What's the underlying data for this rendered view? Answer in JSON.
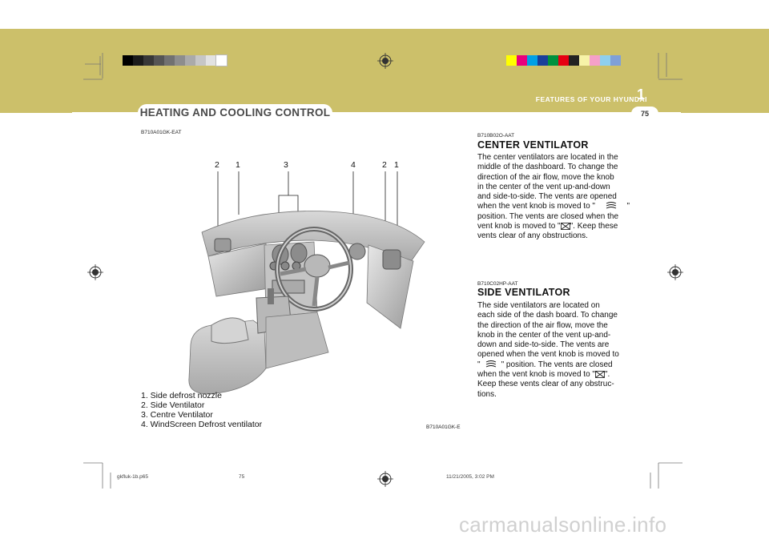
{
  "colors": {
    "header_band": "#ccc06a",
    "text": "#111111",
    "accent_white": "#ffffff"
  },
  "registration_bars": {
    "gray_scale": [
      "#000000",
      "#1c1c1c",
      "#383838",
      "#555555",
      "#717171",
      "#8d8d8d",
      "#aaaaaa",
      "#c6c6c6",
      "#e2e2e2",
      "#ffffff"
    ],
    "color_scale": [
      "#ffff00",
      "#e8007d",
      "#00a0e6",
      "#1a3f9a",
      "#00913e",
      "#e60012",
      "#222222",
      "#f7f3a8",
      "#f5a0c8",
      "#8ecfee",
      "#7fa0d8"
    ]
  },
  "header": {
    "section_title": "HEATING AND COOLING CONTROL",
    "chapter_label": "FEATURES OF YOUR HYUNDAI",
    "chapter_number": "1",
    "page_number": "75"
  },
  "figure": {
    "code_top": "B710A01GK-EAT",
    "code_bottom": "B710A01GK-E",
    "callouts": [
      "2",
      "1",
      "3",
      "4",
      "2",
      "1"
    ],
    "legend": [
      "1. Side defrost nozzle",
      "2. Side Ventilator",
      "3. Centre Ventilator",
      "4. WindScreen Defrost ventilator"
    ]
  },
  "sections": {
    "center": {
      "code": "B710B02O-AAT",
      "heading": "CENTER VENTILATOR",
      "lines": [
        "The center ventilators are located in the",
        "middle of the dashboard. To change the",
        "direction of the air flow, move the knob",
        "in the center of the vent up-and-down",
        "and side-to-side. The vents are opened",
        "when the vent knob is moved to \"",
        "\"",
        "position. The vents are closed when the",
        "vent knob is moved to \"",
        "\". Keep these",
        "vents clear of any obstructions."
      ]
    },
    "side": {
      "code": "B710C02HP-AAT",
      "heading": "SIDE VENTILATOR",
      "lines": [
        "The side ventilators are located on",
        "each side of the dash board. To change",
        "the direction of the air flow, move the",
        "knob in the center of the vent up-and-",
        "down and side-to-side. The vents are",
        "opened when the vent knob is moved to",
        "\"",
        "\" position. The vents are closed",
        "when the vent knob is moved to \"",
        "\".",
        "Keep these vents clear of any obstruc-",
        "tions."
      ]
    }
  },
  "footer": {
    "file": "gkfluk-1b.p65",
    "page": "75",
    "timestamp": "11/21/2005, 3:02 PM"
  },
  "watermark": "carmanualsonline.info"
}
